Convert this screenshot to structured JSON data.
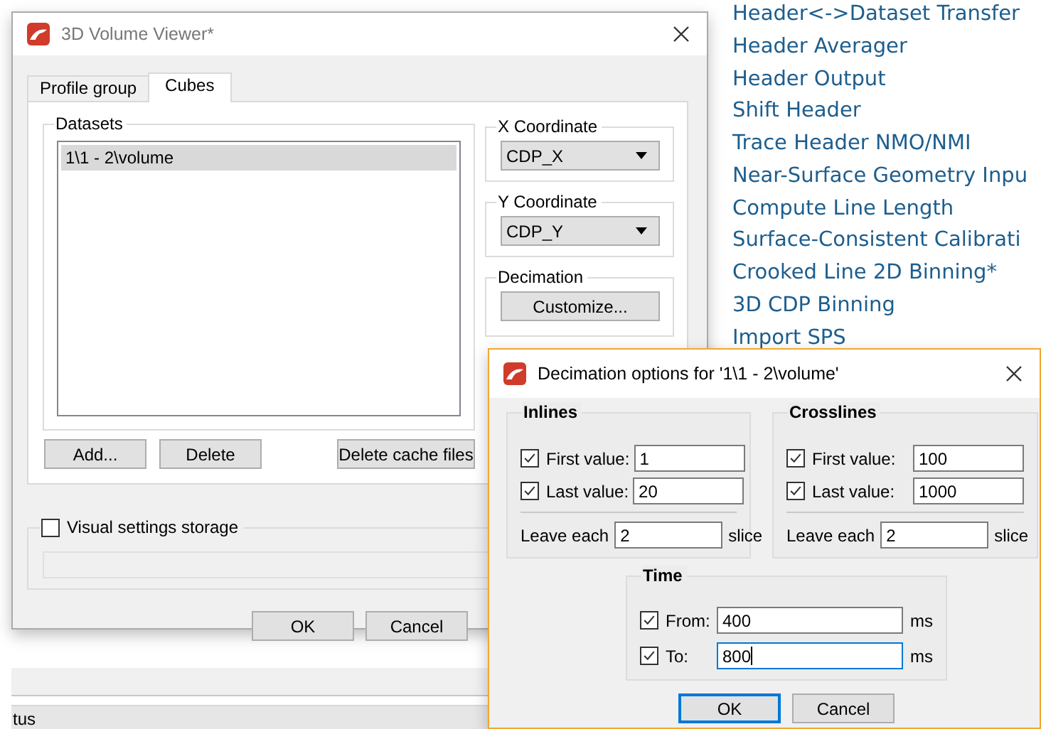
{
  "main_dialog": {
    "title": "3D Volume Viewer*",
    "tabs": [
      {
        "label": "Profile group",
        "selected": false
      },
      {
        "label": "Cubes",
        "selected": true
      }
    ],
    "datasets": {
      "label": "Datasets",
      "items": [
        {
          "label": "1\\1 - 2\\volume",
          "selected": true
        }
      ]
    },
    "x_coordinate": {
      "label": "X Coordinate",
      "value": "CDP_X"
    },
    "y_coordinate": {
      "label": "Y Coordinate",
      "value": "CDP_Y"
    },
    "decimation": {
      "label": "Decimation",
      "button": "Customize..."
    },
    "dataset_buttons": [
      "Add...",
      "Delete",
      "Delete cache files"
    ],
    "visual_settings_storage": {
      "label": "Visual settings storage",
      "checked": false
    },
    "buttons": [
      "OK",
      "Cancel"
    ]
  },
  "tool_list": [
    "Header<->Dataset Transfer",
    "Header Averager",
    "Header Output",
    "Shift Header",
    "Trace Header NMO/NMI",
    "Near-Surface Geometry Inpu",
    "Compute Line Length",
    "Surface-Consistent Calibrati",
    "Crooked Line 2D Binning*",
    "3D CDP Binning",
    "Import SPS"
  ],
  "status_bar": "tus",
  "decimation_dialog": {
    "title": "Decimation options for '1\\1 - 2\\volume'",
    "inlines": {
      "label": "Inlines",
      "rows": [
        {
          "label": "First value:",
          "checked": true,
          "value": "1"
        },
        {
          "label": "Last value:",
          "checked": true,
          "value": "20"
        }
      ],
      "leave_label": "Leave each",
      "leave_value": "2",
      "unit": "slice"
    },
    "crosslines": {
      "label": "Crosslines",
      "rows": [
        {
          "label": "First value:",
          "checked": true,
          "value": "100"
        },
        {
          "label": "Last value:",
          "checked": true,
          "value": "1000"
        }
      ],
      "leave_label": "Leave each",
      "leave_value": "2",
      "unit": "slice"
    },
    "time": {
      "label": "Time",
      "rows": [
        {
          "label": "From:",
          "checked": true,
          "value": "400",
          "unit": "ms",
          "focused": false
        },
        {
          "label": "To:",
          "checked": true,
          "value": "800",
          "unit": "ms",
          "focused": true
        }
      ]
    },
    "buttons": [
      {
        "label": "OK",
        "default": true
      },
      {
        "label": "Cancel",
        "default": false
      }
    ]
  }
}
